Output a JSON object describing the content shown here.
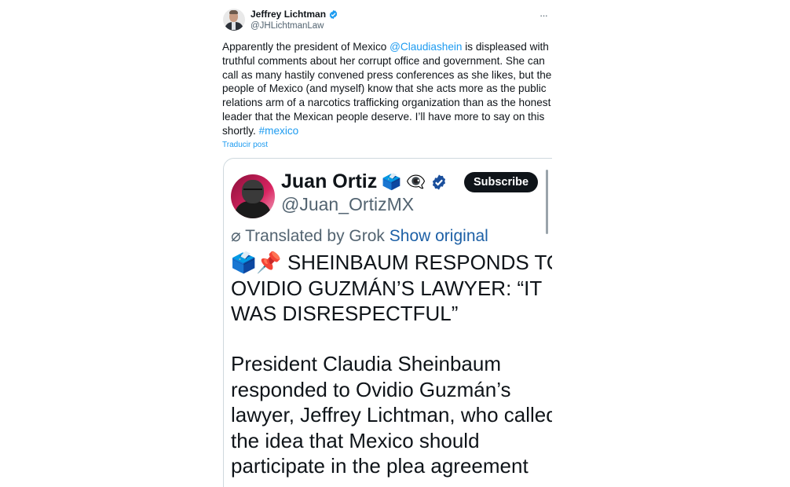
{
  "post": {
    "author_name": "Jeffrey Lichtman",
    "author_handle": "@JHLichtmanLaw",
    "more_icon": "more-horizontal-icon",
    "text_lines": [
      [
        "Apparently the president of Mexico ",
        "@Claudiashein",
        " is displeased with my"
      ],
      "truthful comments about her corrupt office and government. She can",
      "call as many hastily convened press conferences as she likes, but the",
      "people of Mexico (and myself) know that she acts more as the public",
      "relations arm of a narcotics trafficking organization than as the honest",
      "leader that the Mexican people deserve. I’ll have more to say on this",
      [
        "shortly. ",
        "#mexico"
      ]
    ],
    "translate_label": "Traducir post"
  },
  "quoted": {
    "name": "Juan Ortiz",
    "name_emojis": [
      "🗳️",
      "👁‍🗨"
    ],
    "handle": "@Juan_OrtizMX",
    "subscribe_label": "Subscribe",
    "translated_by": "Translated by Grok",
    "show_original": "Show original",
    "headline_lines": [
      "🗳️📌 SHEINBAUM RESPONDS TO",
      "OVIDIO GUZMÁN’S LAWYER: “IT",
      "WAS DISRESPECTFUL”"
    ],
    "body_lines": [
      "President Claudia Sheinbaum",
      "responded to Ovidio Guzmán’s",
      "lawyer, Jeffrey Lichtman, who called",
      "the idea that Mexico should",
      "participate in the plea agreement"
    ]
  },
  "colors": {
    "link": "#1d9bf0",
    "verified": "#1d9bf0",
    "text": "#0f1419",
    "muted": "#536471"
  }
}
